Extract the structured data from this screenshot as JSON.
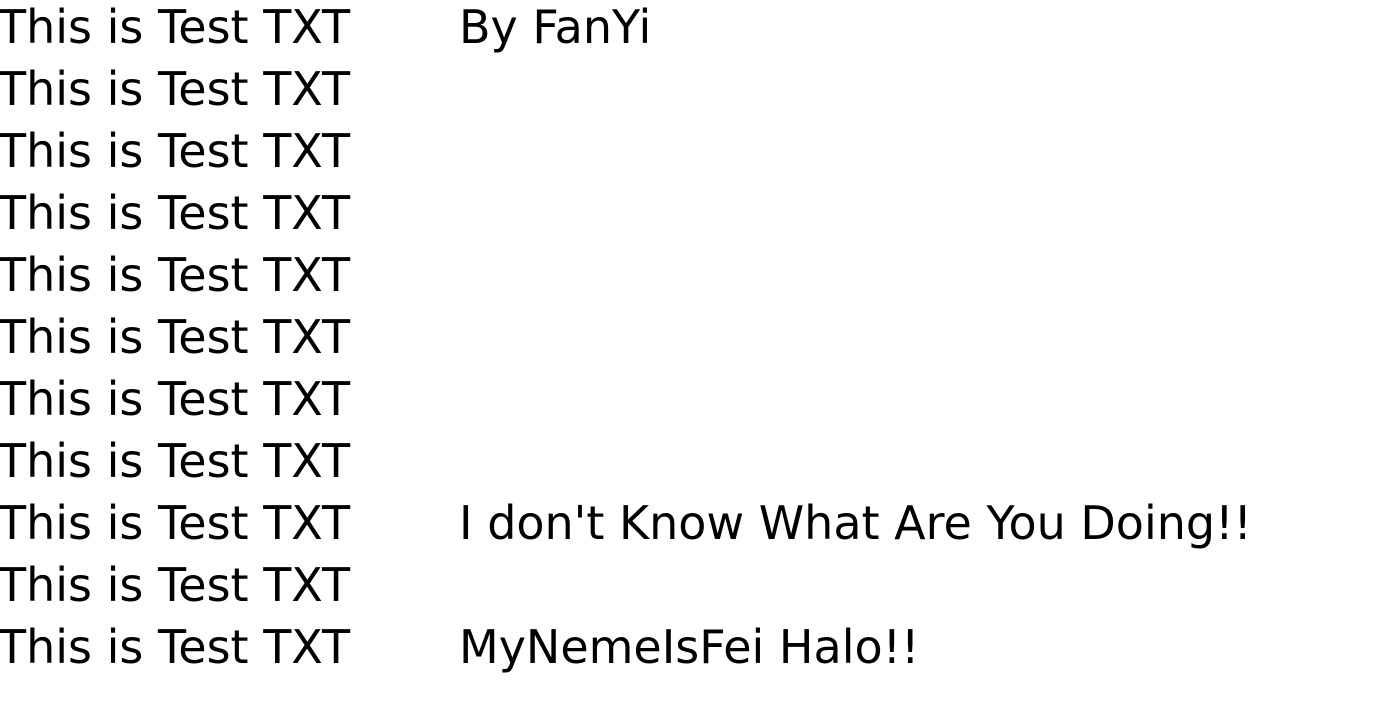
{
  "lines": [
    {
      "left": "This is Test TXT",
      "right": "By FanYi"
    },
    {
      "left": "This is Test TXT",
      "right": ""
    },
    {
      "left": "This is Test TXT",
      "right": ""
    },
    {
      "left": "This is Test TXT",
      "right": ""
    },
    {
      "left": "This is Test TXT",
      "right": ""
    },
    {
      "left": "This is Test TXT",
      "right": ""
    },
    {
      "left": "This is Test TXT",
      "right": ""
    },
    {
      "left": "This is Test TXT",
      "right": ""
    },
    {
      "left": "This is Test TXT",
      "right": "I don't Know What Are You Doing!!"
    },
    {
      "left": "This is Test TXT",
      "right": ""
    },
    {
      "left": "This is Test TXT",
      "right": "MyNemeIsFei Halo!!"
    }
  ]
}
